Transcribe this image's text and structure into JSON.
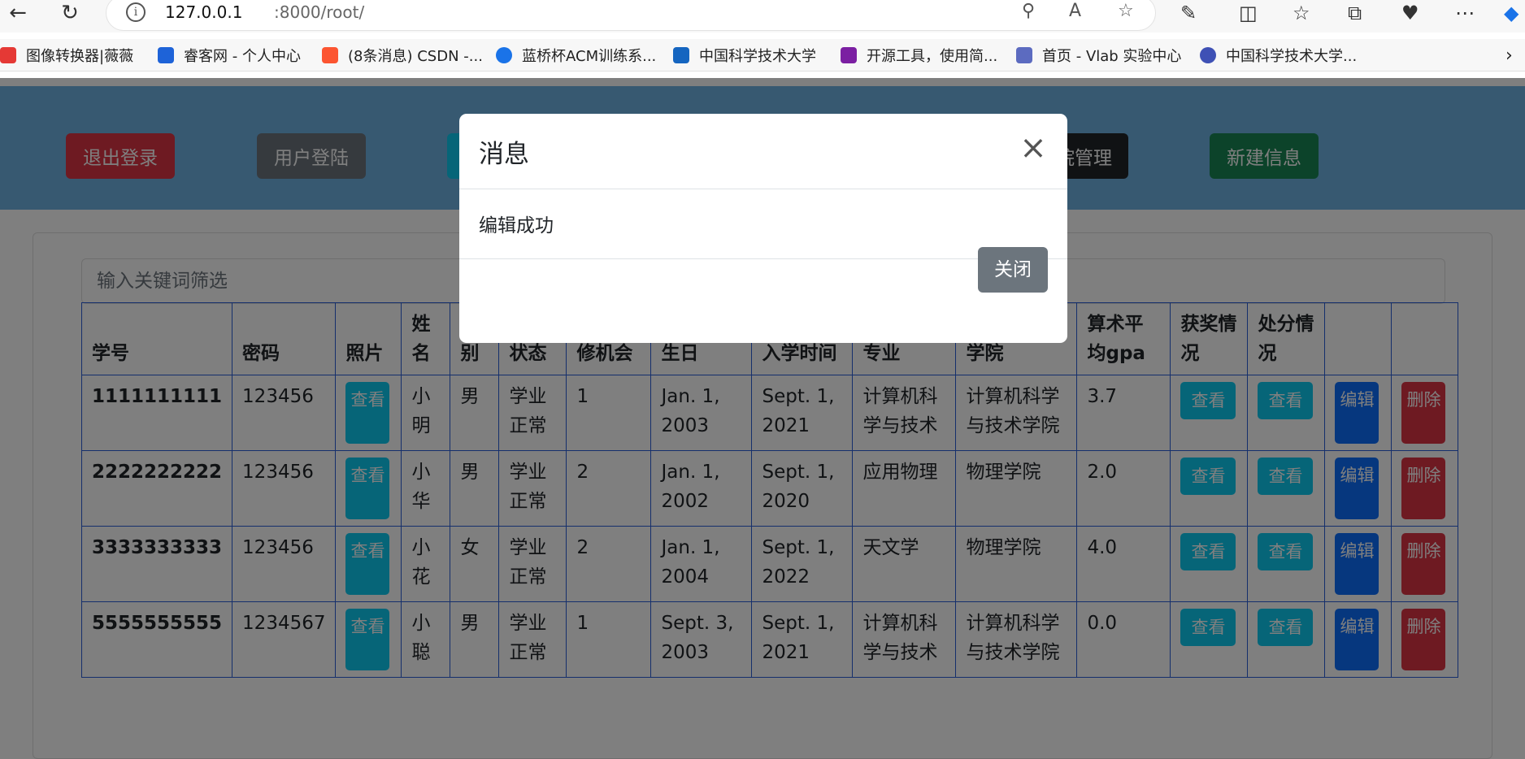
{
  "browser": {
    "url_host": "127.0.0.1",
    "url_path": ":8000/root/",
    "bookmarks": [
      {
        "label": "图像转换器|薇薇",
        "color": "#e53935"
      },
      {
        "label": "睿客网 - 个人中心",
        "color": "#1e63d8"
      },
      {
        "label": "(8条消息) CSDN -...",
        "color": "#fc5531"
      },
      {
        "label": "蓝桥杯ACM训练系...",
        "color": "#1a73e8"
      },
      {
        "label": "中国科学技术大学",
        "color": "#1565c0"
      },
      {
        "label": "开源工具，使用简...",
        "color": "#7b1fa2"
      },
      {
        "label": "首页 - Vlab 实验中心",
        "color": "#5c6bc0"
      },
      {
        "label": "中国科学技术大学...",
        "color": "#3f51b5"
      }
    ]
  },
  "header_buttons": {
    "logout": "退出登录",
    "login": "用户登陆",
    "manage": "院管理",
    "new_info": "新建信息"
  },
  "search": {
    "placeholder": "输入关键词筛选"
  },
  "table": {
    "headers": [
      "学号",
      "密码",
      "照片",
      "姓名",
      "性别",
      "状态",
      "修机会",
      "生日",
      "入学时间",
      "专业",
      "学院",
      "算术平均gpa",
      "获奖情况",
      "处分情况",
      "",
      ""
    ],
    "rows": [
      {
        "id": "1111111111",
        "password": "123456",
        "photo": "查看",
        "name": "小明",
        "gender": "男",
        "status": "学业正常",
        "chance": "1",
        "birthday": "Jan. 1, 2003",
        "enroll": "Sept. 1, 2021",
        "major": "计算机科学与技术",
        "college": "计算机科学与技术学院",
        "gpa": "3.7",
        "award": "查看",
        "punish": "查看",
        "edit": "编辑",
        "delete": "删除"
      },
      {
        "id": "2222222222",
        "password": "123456",
        "photo": "查看",
        "name": "小华",
        "gender": "男",
        "status": "学业正常",
        "chance": "2",
        "birthday": "Jan. 1, 2002",
        "enroll": "Sept. 1, 2020",
        "major": "应用物理",
        "college": "物理学院",
        "gpa": "2.0",
        "award": "查看",
        "punish": "查看",
        "edit": "编辑",
        "delete": "删除"
      },
      {
        "id": "3333333333",
        "password": "123456",
        "photo": "查看",
        "name": "小花",
        "gender": "女",
        "status": "学业正常",
        "chance": "2",
        "birthday": "Jan. 1, 2004",
        "enroll": "Sept. 1, 2022",
        "major": "天文学",
        "college": "物理学院",
        "gpa": "4.0",
        "award": "查看",
        "punish": "查看",
        "edit": "编辑",
        "delete": "删除"
      },
      {
        "id": "5555555555",
        "password": "1234567",
        "photo": "查看",
        "name": "小聪",
        "gender": "男",
        "status": "学业正常",
        "chance": "1",
        "birthday": "Sept. 3, 2003",
        "enroll": "Sept. 1, 2021",
        "major": "计算机科学与技术",
        "college": "计算机科学与技术学院",
        "gpa": "0.0",
        "award": "查看",
        "punish": "查看",
        "edit": "编辑",
        "delete": "删除"
      }
    ]
  },
  "modal": {
    "title": "消息",
    "body": "编辑成功",
    "close_button": "关闭"
  }
}
